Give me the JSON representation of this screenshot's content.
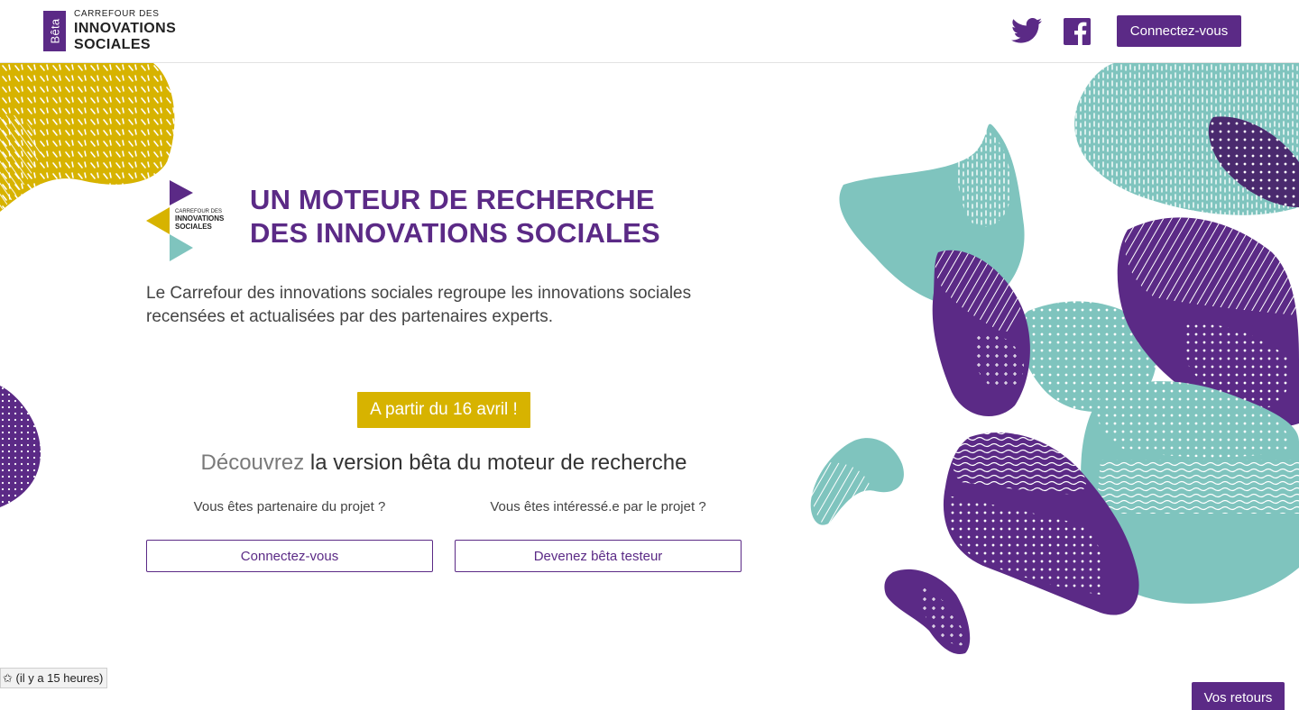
{
  "header": {
    "beta_label": "Bêta",
    "logo_line1": "CARREFOUR DES",
    "logo_line2": "INNOVATIONS",
    "logo_line3": "SOCIALES",
    "connect_label": "Connectez-vous"
  },
  "hero": {
    "logo_line1": "CARREFOUR DES",
    "logo_line2": "INNOVATIONS",
    "logo_line3": "SOCIALES",
    "title_line1": "UN MOTEUR DE RECHERCHE",
    "title_line2": "DES INNOVATIONS SOCIALES",
    "description": "Le Carrefour des innovations sociales regroupe les innovations sociales recensées et actualisées par des partenaires experts.",
    "date_badge": "A partir du 16 avril !",
    "discover_light": "Découvrez",
    "discover_strong": "la version bêta du moteur de recherche"
  },
  "partners": {
    "question": "Vous êtes partenaire du projet ?",
    "button": "Connectez-vous"
  },
  "interested": {
    "question": "Vous êtes intéressé.e par le projet ?",
    "button": "Devenez bêta testeur"
  },
  "history_chip": "✩ (il y a 15 heures)",
  "feedback_button": "Vos retours",
  "colors": {
    "purple": "#5b2a86",
    "yellow": "#d7b300",
    "teal": "#7fc4be",
    "text": "#444444"
  },
  "icons": [
    "twitter-icon",
    "facebook-icon"
  ]
}
